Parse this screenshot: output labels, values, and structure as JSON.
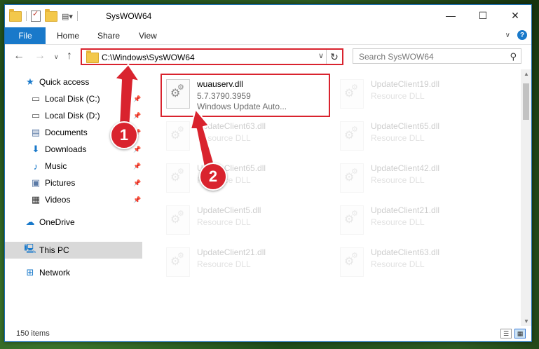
{
  "window": {
    "title": "SysWOW64",
    "controls": [
      "—",
      "☐",
      "✕"
    ]
  },
  "ribbon": {
    "tabs": [
      "File",
      "Home",
      "Share",
      "View"
    ]
  },
  "address": {
    "path": "C:\\Windows\\SysWOW64"
  },
  "search": {
    "placeholder": "Search SysWOW64"
  },
  "sidebar": {
    "items": [
      {
        "label": "Quick access",
        "icon": "star-icon"
      },
      {
        "label": "Local Disk (C:)",
        "icon": "drive-icon",
        "pinned": true
      },
      {
        "label": "Local Disk (D:)",
        "icon": "drive-icon",
        "pinned": true
      },
      {
        "label": "Documents",
        "icon": "documents-icon",
        "pinned": true
      },
      {
        "label": "Downloads",
        "icon": "download-icon",
        "pinned": true
      },
      {
        "label": "Music",
        "icon": "music-icon",
        "pinned": true
      },
      {
        "label": "Pictures",
        "icon": "pictures-icon",
        "pinned": true
      },
      {
        "label": "Videos",
        "icon": "videos-icon",
        "pinned": true
      },
      {
        "label": "OneDrive",
        "icon": "cloud-icon"
      },
      {
        "label": "This PC",
        "icon": "computer-icon",
        "selected": true
      },
      {
        "label": "Network",
        "icon": "network-icon"
      }
    ]
  },
  "files": [
    {
      "name": "wuauserv.dll",
      "line1": "5.7.3790.3959",
      "line2": "Windows Update Auto..."
    },
    {
      "name": "UpdateClient19.dll",
      "line1": "Resource DLL"
    },
    {
      "name": "UpdateClient63.dll",
      "line1": "Resource DLL"
    },
    {
      "name": "UpdateClient65.dll",
      "line1": "Resource DLL"
    },
    {
      "name": "UpdateClient65.dll",
      "line1": "Resource DLL"
    },
    {
      "name": "UpdateClient42.dll",
      "line1": "Resource DLL"
    },
    {
      "name": "UpdateClient5.dll",
      "line1": "Resource DLL"
    },
    {
      "name": "UpdateClient21.dll",
      "line1": "Resource DLL"
    },
    {
      "name": "UpdateClient21.dll",
      "line1": "Resource DLL"
    },
    {
      "name": "UpdateClient63.dll",
      "line1": "Resource DLL"
    }
  ],
  "status": {
    "item_count": "150 items"
  },
  "annotations": {
    "step1": "1",
    "step2": "2",
    "accent": "#d9232e"
  }
}
